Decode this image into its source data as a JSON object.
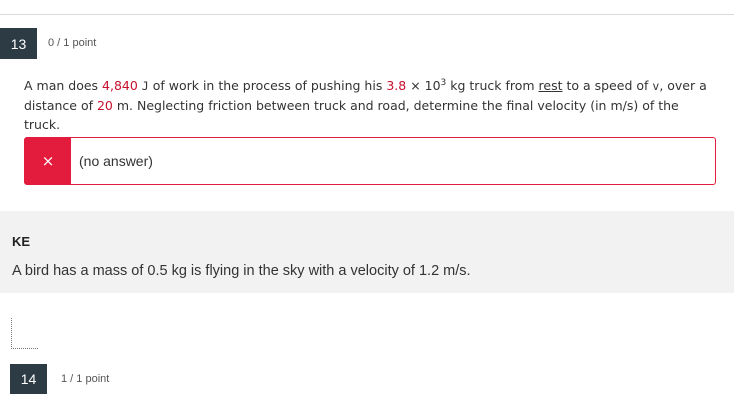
{
  "question13": {
    "number": "13",
    "points": "0 / 1 point",
    "text": {
      "t1": "A man does ",
      "work": "4,840",
      "t2": " ",
      "work_unit": "J",
      "t3": " of work in the process of pushing his ",
      "mass": "3.8",
      "times": " × 10",
      "exp": "3",
      "t4": " kg truck from ",
      "rest": "rest",
      "t5": " to a speed of ",
      "v": "v",
      "t6": ", over a distance of ",
      "distance": "20",
      "t7": " m. Neglecting friction between truck and road, determine the final velocity (in m/s) of the truck."
    },
    "answer": {
      "status_icon": "×",
      "value": "(no answer)"
    }
  },
  "ke_section": {
    "title": "KE",
    "text": "A bird has a mass of 0.5 kg is flying in the sky with a velocity of 1.2 m/s."
  },
  "question14": {
    "number": "14",
    "points": "1 / 1 point"
  },
  "colors": {
    "incorrect": "#e31b3c",
    "number_badge": "#2d3b45",
    "highlight_value": "#c8102e",
    "panel_bg": "#f2f2f2"
  }
}
